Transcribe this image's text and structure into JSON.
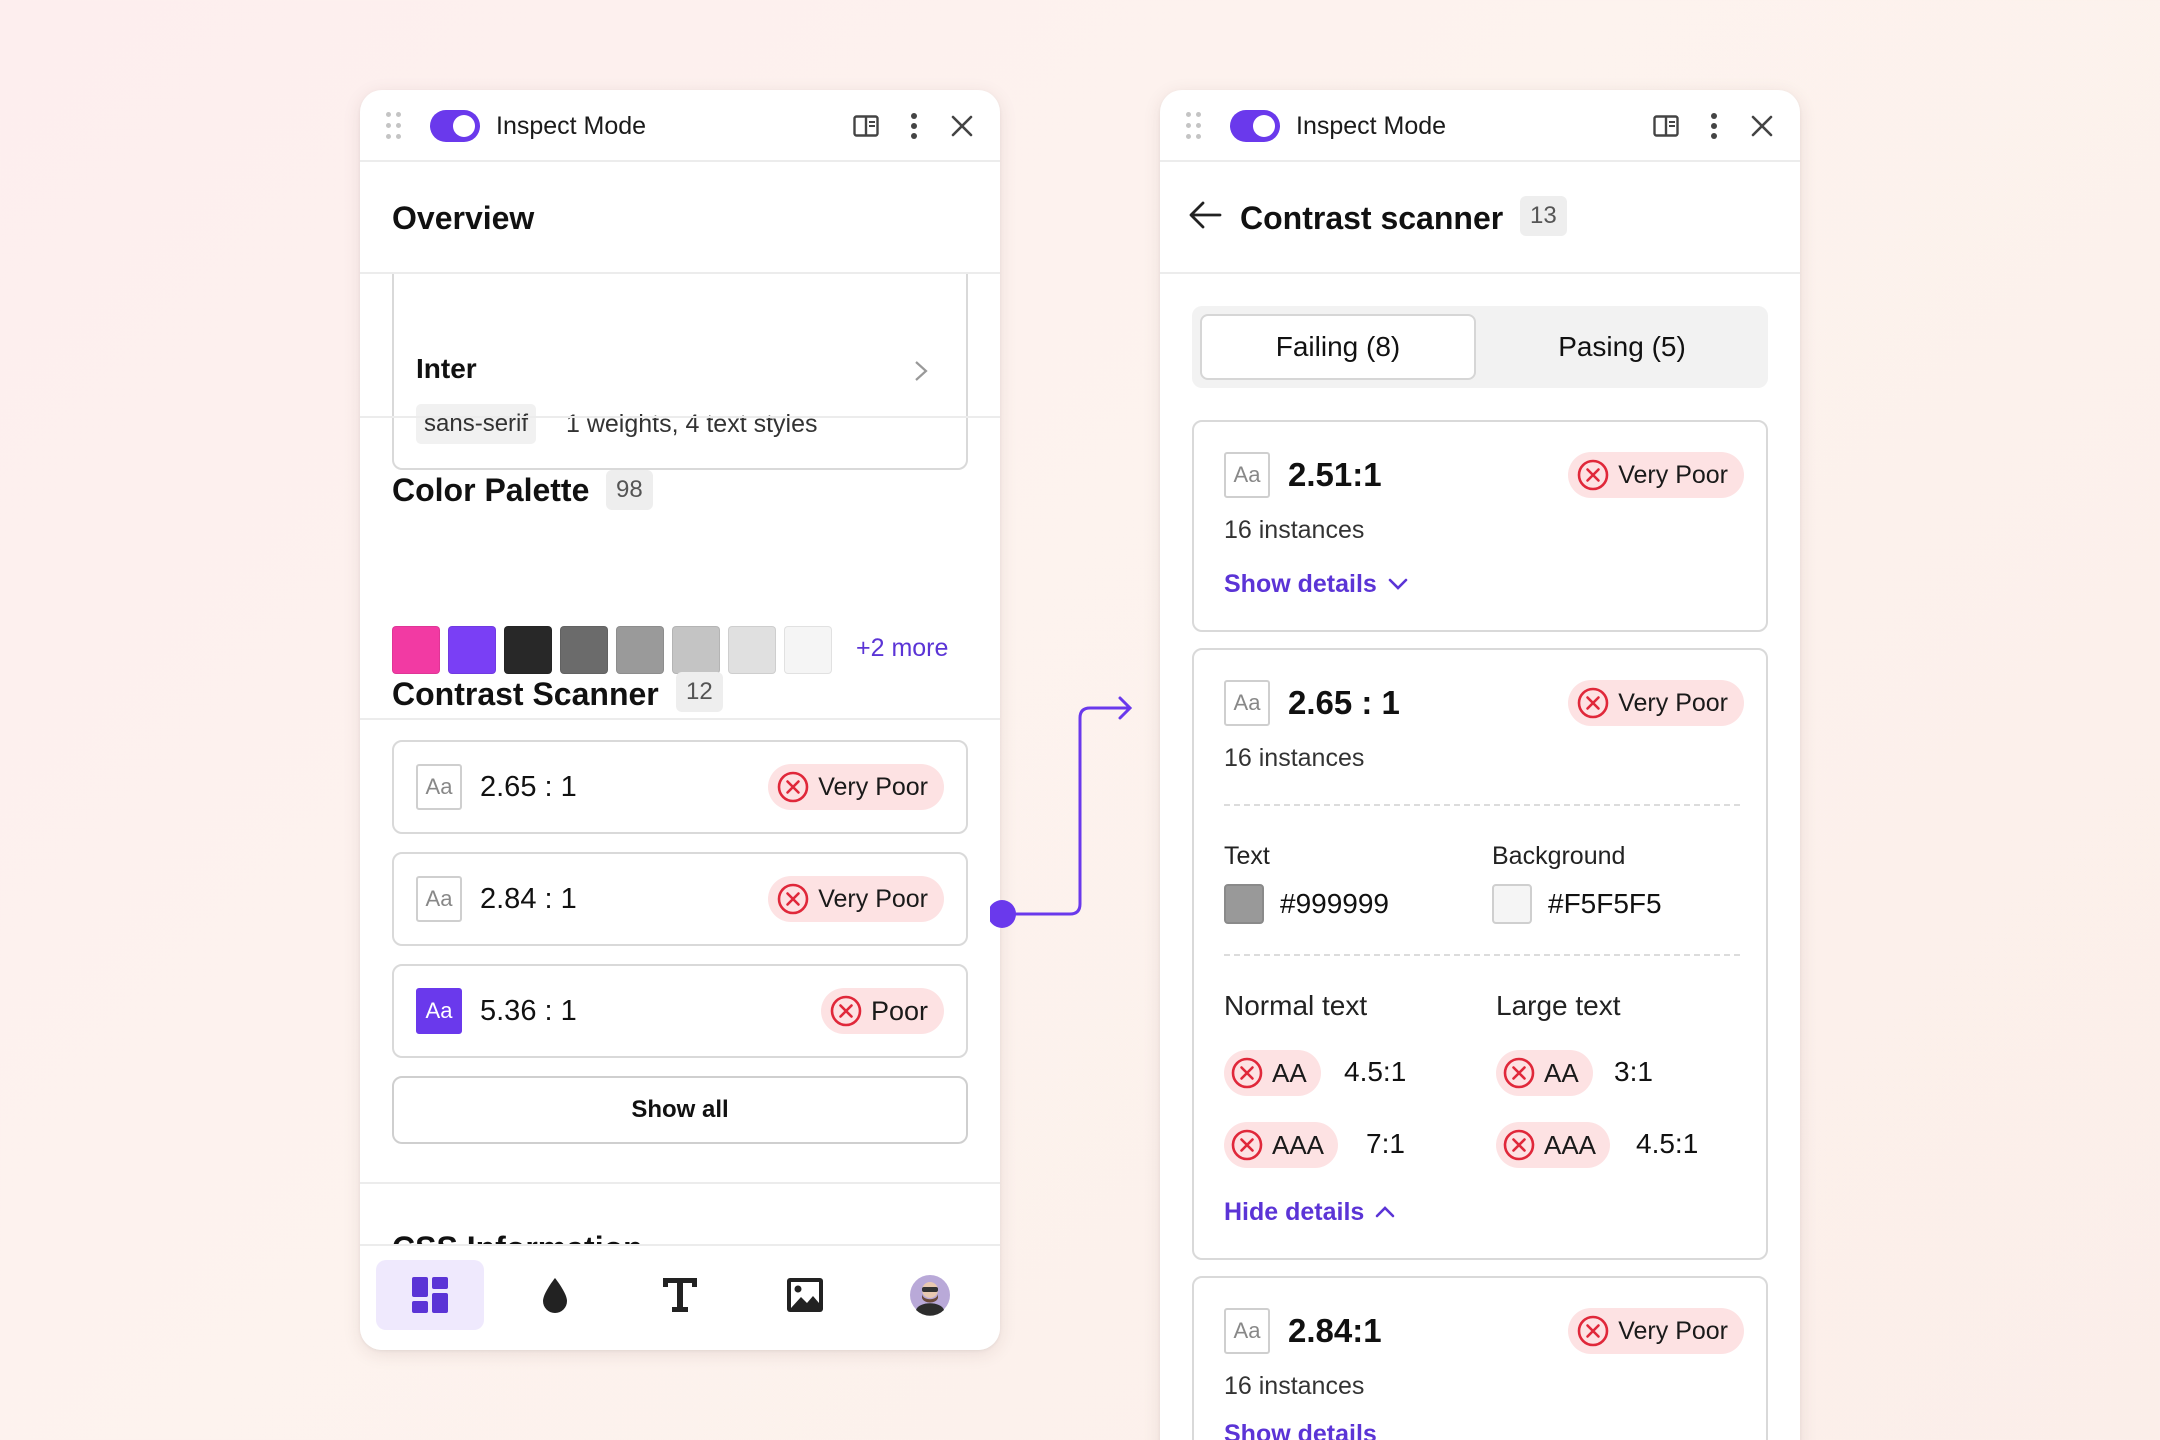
{
  "left_panel": {
    "topbar": {
      "title": "Inspect Mode"
    },
    "overview": {
      "title": "Overview",
      "font_card": {
        "name": "Inter",
        "category": "sans-serif",
        "details": "1 weights, 4 text styles"
      }
    },
    "color_palette": {
      "title": "Color Palette",
      "count": "98",
      "swatches": [
        "#f23aa3",
        "#7a3ff5",
        "#282828",
        "#6b6b6b",
        "#9a9a9a",
        "#c4c4c4",
        "#e0e0e0",
        "#f5f5f5"
      ],
      "more_link": "+2 more"
    },
    "contrast_scanner": {
      "title": "Contrast Scanner",
      "count": "12",
      "items": [
        {
          "sample": "Aa",
          "ratio": "2.65 : 1",
          "status": "Very Poor"
        },
        {
          "sample": "Aa",
          "ratio": "2.84 : 1",
          "status": "Very Poor"
        },
        {
          "sample": "Aa",
          "ratio": "5.36 : 1",
          "status": "Poor"
        }
      ],
      "show_all": "Show all"
    },
    "css_information": {
      "title": "CSS Information"
    },
    "bottom_nav": [
      "overview-icon",
      "color-drop-icon",
      "typography-icon",
      "image-icon",
      "profile-avatar"
    ]
  },
  "right_panel": {
    "topbar": {
      "title": "Inspect Mode"
    },
    "header": {
      "title": "Contrast scanner",
      "count": "13"
    },
    "tabs": {
      "failing": "Failing (8)",
      "passing": "Pasing (5)"
    },
    "results": [
      {
        "sample": "Aa",
        "ratio": "2.51:1",
        "status": "Very Poor",
        "instances": "16 instances",
        "toggle": "Show details"
      },
      {
        "sample": "Aa",
        "ratio": "2.65 : 1",
        "status": "Very Poor",
        "instances": "16 instances",
        "text_label": "Text",
        "text_color": "#999999",
        "bg_label": "Background",
        "bg_color": "#F5F5F5",
        "normal_label": "Normal text",
        "large_label": "Large text",
        "normal_aa_level": "AA",
        "normal_aa_value": "4.5:1",
        "normal_aaa_level": "AAA",
        "normal_aaa_value": "7:1",
        "large_aa_level": "AA",
        "large_aa_value": "3:1",
        "large_aaa_level": "AAA",
        "large_aaa_value": "4.5:1",
        "toggle": "Hide details"
      },
      {
        "sample": "Aa",
        "ratio": "2.84:1",
        "status": "Very Poor",
        "instances": "16 instances",
        "toggle": "Show details"
      }
    ]
  },
  "colors": {
    "accent": "#6a39ec",
    "link": "#5b34d6",
    "fail_bg": "#fde2e3",
    "fail_icon": "#e0283a"
  }
}
